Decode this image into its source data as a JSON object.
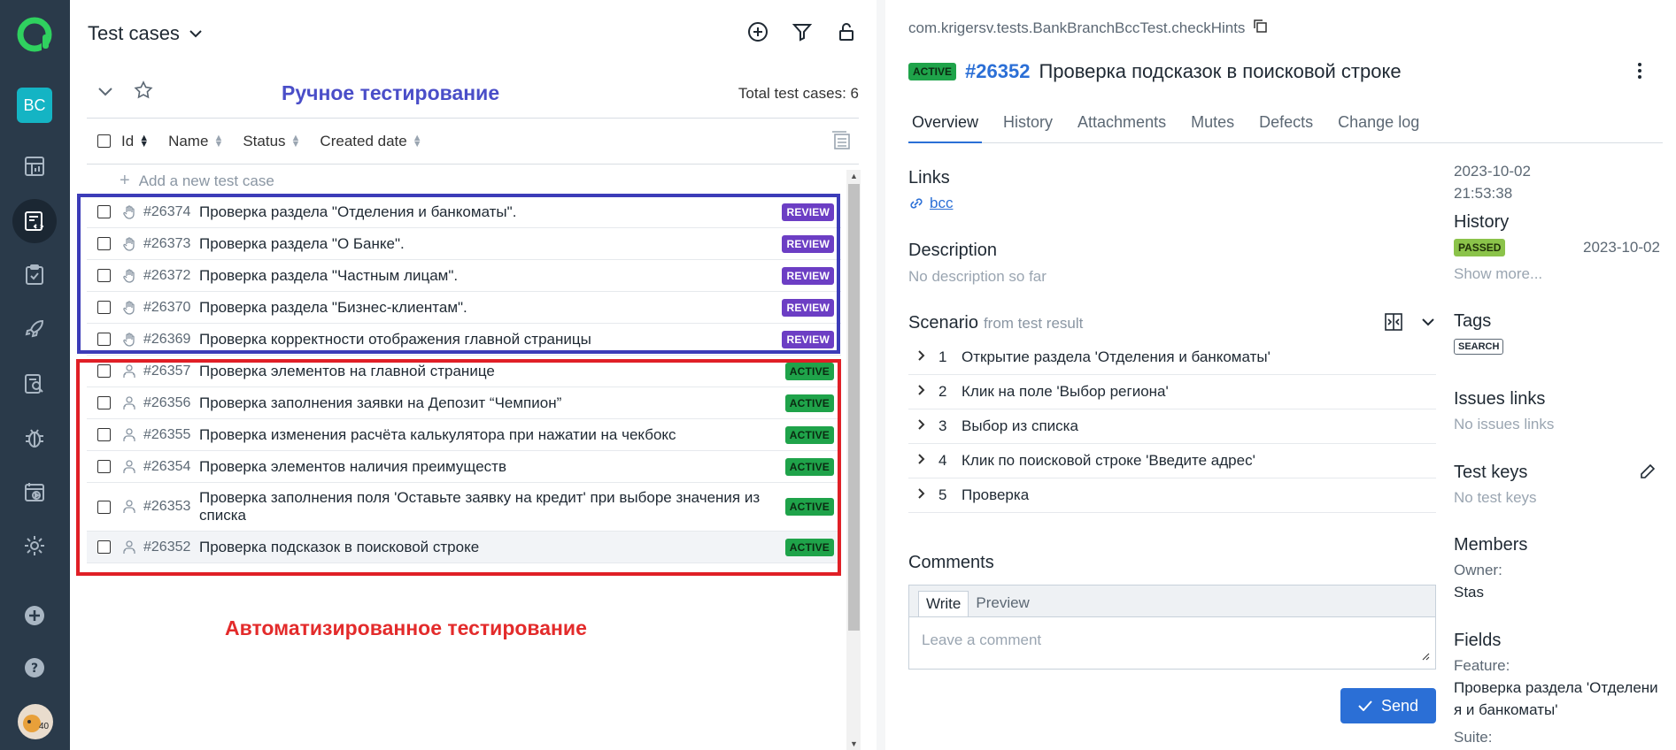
{
  "nav": {
    "project_initials": "BC",
    "items": [
      {
        "icon": "dashboard-icon"
      },
      {
        "icon": "test-cases-icon",
        "active": true
      },
      {
        "icon": "test-plans-icon"
      },
      {
        "icon": "launches-icon"
      },
      {
        "icon": "analytics-icon"
      },
      {
        "icon": "defects-icon"
      },
      {
        "icon": "jobs-icon"
      },
      {
        "icon": "settings-icon"
      }
    ],
    "avatar_text": "40"
  },
  "list": {
    "title": "Test cases",
    "total_label": "Total test cases: 6",
    "manual_annotation": "Ручное тестирование",
    "auto_annotation": "Автоматизированное тестирование",
    "columns": [
      "Id",
      "Name",
      "Status",
      "Created date"
    ],
    "add_placeholder": "Add a new test case",
    "rows": [
      {
        "id": "#26374",
        "name": "Проверка раздела \"Отделения и банкоматы\".",
        "status": "REVIEW",
        "type": "manual"
      },
      {
        "id": "#26373",
        "name": "Проверка раздела \"О Банке\".",
        "status": "REVIEW",
        "type": "manual"
      },
      {
        "id": "#26372",
        "name": "Проверка раздела \"Частным лицам\".",
        "status": "REVIEW",
        "type": "manual"
      },
      {
        "id": "#26370",
        "name": "Проверка раздела \"Бизнес-клиентам\".",
        "status": "REVIEW",
        "type": "manual"
      },
      {
        "id": "#26369",
        "name": "Проверка корректности отображения главной страницы",
        "status": "REVIEW",
        "type": "manual"
      },
      {
        "id": "#26357",
        "name": "Проверка элементов на главной странице",
        "status": "ACTIVE",
        "type": "auto"
      },
      {
        "id": "#26356",
        "name": "Проверка заполнения заявки на Депозит “Чемпион”",
        "status": "ACTIVE",
        "type": "auto"
      },
      {
        "id": "#26355",
        "name": "Проверка изменения расчёта калькулятора при нажатии на чекбокс",
        "status": "ACTIVE",
        "type": "auto"
      },
      {
        "id": "#26354",
        "name": "Проверка элементов наличия преимуществ",
        "status": "ACTIVE",
        "type": "auto"
      },
      {
        "id": "#26353",
        "name": "Проверка заполнения поля 'Оставьте заявку на кредит' при выборе значения из списка",
        "status": "ACTIVE",
        "type": "auto",
        "tall": true
      },
      {
        "id": "#26352",
        "name": "Проверка подсказок в поисковой строке",
        "status": "ACTIVE",
        "type": "auto",
        "selected": true
      }
    ]
  },
  "detail": {
    "path": "com.krigersv.tests.BankBranchBccTest.checkHints",
    "status": "ACTIVE",
    "number": "#26352",
    "title": "Проверка подсказок в поисковой строке",
    "tabs": [
      "Overview",
      "History",
      "Attachments",
      "Mutes",
      "Defects",
      "Change log"
    ],
    "links_title": "Links",
    "link": "bcc",
    "description_title": "Description",
    "description": "No description so far",
    "scenario_title": "Scenario",
    "scenario_from": "from test result",
    "steps": [
      {
        "n": "1",
        "text": "Открытие раздела 'Отделения и банкоматы'"
      },
      {
        "n": "2",
        "text": "Клик на поле 'Выбор региона'"
      },
      {
        "n": "3",
        "text": "Выбор из списка"
      },
      {
        "n": "4",
        "text": "Клик по поисковой строке 'Введите адрес'"
      },
      {
        "n": "5",
        "text": "Проверка"
      }
    ],
    "comments_title": "Comments",
    "comment_tabs": [
      "Write",
      "Preview"
    ],
    "comment_placeholder": "Leave a comment",
    "send_label": "Send",
    "side": {
      "created_date": "2023-10-02",
      "created_time": "21:53:38",
      "history_title": "History",
      "history_status": "PASSED",
      "history_date": "2023-10-02",
      "show_more": "Show more...",
      "tags_title": "Tags",
      "tag": "SEARCH",
      "issues_title": "Issues links",
      "issues_empty": "No issues links",
      "keys_title": "Test keys",
      "keys_empty": "No test keys",
      "members_title": "Members",
      "owner_label": "Owner:",
      "owner": "Stas",
      "fields_title": "Fields",
      "feature_label": "Feature:",
      "feature_value_1": "Проверка раздела 'Отделени",
      "feature_value_2": "я и банкоматы'",
      "suite_label": "Suite:"
    }
  }
}
